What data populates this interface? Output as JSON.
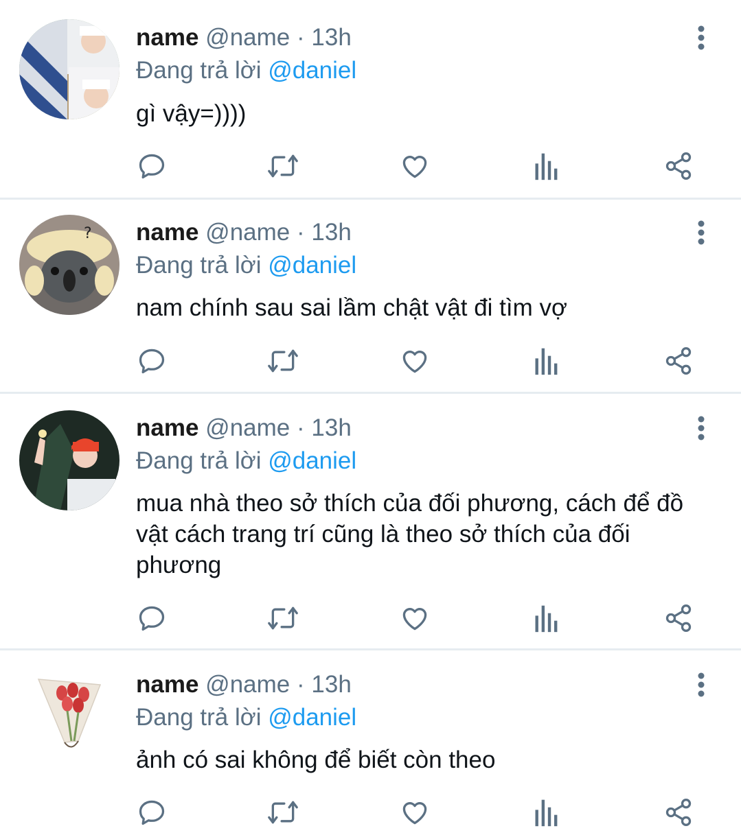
{
  "colors": {
    "accent": "#1d9bf0",
    "muted": "#5b7083",
    "text": "#0f1419",
    "divider": "#e6ecf0",
    "icon": "#5b7083"
  },
  "actions_icons": [
    "reply-icon",
    "retweet-icon",
    "like-icon",
    "analytics-icon",
    "share-icon"
  ],
  "tweets": [
    {
      "name": "name",
      "handle": "@name",
      "separator": "·",
      "time": "13h",
      "reply_prefix": "Đang trả lời",
      "reply_to": "@daniel",
      "text": "gì vậy=))))"
    },
    {
      "name": "name",
      "handle": "@name",
      "separator": "·",
      "time": "13h",
      "reply_prefix": "Đang trả lời",
      "reply_to": "@daniel",
      "text": "nam chính sau sai lầm chật vật đi tìm vợ"
    },
    {
      "name": "name",
      "handle": "@name",
      "separator": "·",
      "time": "13h",
      "reply_prefix": "Đang trả lời",
      "reply_to": "@daniel",
      "text": "mua nhà theo sở thích của đối phương, cách để đồ vật cách trang trí cũng là theo sở thích của đối phương"
    },
    {
      "name": "name",
      "handle": "@name",
      "separator": "·",
      "time": "13h",
      "reply_prefix": "Đang trả lời",
      "reply_to": "@daniel",
      "text": "ảnh có sai không để biết còn theo"
    }
  ]
}
